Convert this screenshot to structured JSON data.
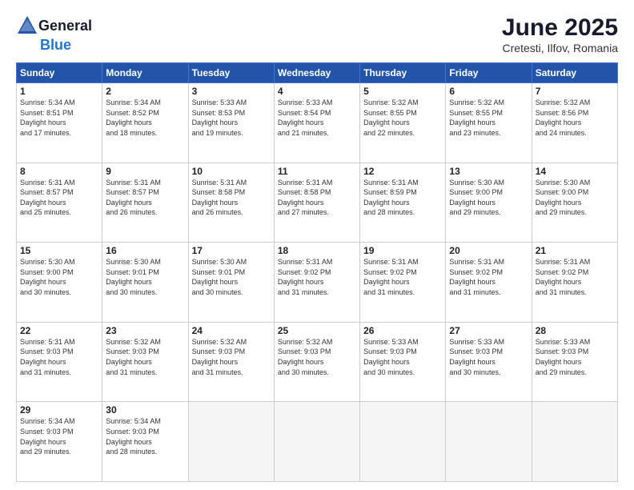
{
  "header": {
    "logo_line1": "General",
    "logo_line2": "Blue",
    "title": "June 2025",
    "subtitle": "Cretesti, Ilfov, Romania"
  },
  "days_of_week": [
    "Sunday",
    "Monday",
    "Tuesday",
    "Wednesday",
    "Thursday",
    "Friday",
    "Saturday"
  ],
  "weeks": [
    [
      {
        "day": 1,
        "sunrise": "5:34 AM",
        "sunset": "8:51 PM",
        "daylight": "15 hours and 17 minutes."
      },
      {
        "day": 2,
        "sunrise": "5:34 AM",
        "sunset": "8:52 PM",
        "daylight": "15 hours and 18 minutes."
      },
      {
        "day": 3,
        "sunrise": "5:33 AM",
        "sunset": "8:53 PM",
        "daylight": "15 hours and 19 minutes."
      },
      {
        "day": 4,
        "sunrise": "5:33 AM",
        "sunset": "8:54 PM",
        "daylight": "15 hours and 21 minutes."
      },
      {
        "day": 5,
        "sunrise": "5:32 AM",
        "sunset": "8:55 PM",
        "daylight": "15 hours and 22 minutes."
      },
      {
        "day": 6,
        "sunrise": "5:32 AM",
        "sunset": "8:55 PM",
        "daylight": "15 hours and 23 minutes."
      },
      {
        "day": 7,
        "sunrise": "5:32 AM",
        "sunset": "8:56 PM",
        "daylight": "15 hours and 24 minutes."
      }
    ],
    [
      {
        "day": 8,
        "sunrise": "5:31 AM",
        "sunset": "8:57 PM",
        "daylight": "15 hours and 25 minutes."
      },
      {
        "day": 9,
        "sunrise": "5:31 AM",
        "sunset": "8:57 PM",
        "daylight": "15 hours and 26 minutes."
      },
      {
        "day": 10,
        "sunrise": "5:31 AM",
        "sunset": "8:58 PM",
        "daylight": "15 hours and 26 minutes."
      },
      {
        "day": 11,
        "sunrise": "5:31 AM",
        "sunset": "8:58 PM",
        "daylight": "15 hours and 27 minutes."
      },
      {
        "day": 12,
        "sunrise": "5:31 AM",
        "sunset": "8:59 PM",
        "daylight": "15 hours and 28 minutes."
      },
      {
        "day": 13,
        "sunrise": "5:30 AM",
        "sunset": "9:00 PM",
        "daylight": "15 hours and 29 minutes."
      },
      {
        "day": 14,
        "sunrise": "5:30 AM",
        "sunset": "9:00 PM",
        "daylight": "15 hours and 29 minutes."
      }
    ],
    [
      {
        "day": 15,
        "sunrise": "5:30 AM",
        "sunset": "9:00 PM",
        "daylight": "15 hours and 30 minutes."
      },
      {
        "day": 16,
        "sunrise": "5:30 AM",
        "sunset": "9:01 PM",
        "daylight": "15 hours and 30 minutes."
      },
      {
        "day": 17,
        "sunrise": "5:30 AM",
        "sunset": "9:01 PM",
        "daylight": "15 hours and 30 minutes."
      },
      {
        "day": 18,
        "sunrise": "5:31 AM",
        "sunset": "9:02 PM",
        "daylight": "15 hours and 31 minutes."
      },
      {
        "day": 19,
        "sunrise": "5:31 AM",
        "sunset": "9:02 PM",
        "daylight": "15 hours and 31 minutes."
      },
      {
        "day": 20,
        "sunrise": "5:31 AM",
        "sunset": "9:02 PM",
        "daylight": "15 hours and 31 minutes."
      },
      {
        "day": 21,
        "sunrise": "5:31 AM",
        "sunset": "9:02 PM",
        "daylight": "15 hours and 31 minutes."
      }
    ],
    [
      {
        "day": 22,
        "sunrise": "5:31 AM",
        "sunset": "9:03 PM",
        "daylight": "15 hours and 31 minutes."
      },
      {
        "day": 23,
        "sunrise": "5:32 AM",
        "sunset": "9:03 PM",
        "daylight": "15 hours and 31 minutes."
      },
      {
        "day": 24,
        "sunrise": "5:32 AM",
        "sunset": "9:03 PM",
        "daylight": "15 hours and 31 minutes."
      },
      {
        "day": 25,
        "sunrise": "5:32 AM",
        "sunset": "9:03 PM",
        "daylight": "15 hours and 30 minutes."
      },
      {
        "day": 26,
        "sunrise": "5:33 AM",
        "sunset": "9:03 PM",
        "daylight": "15 hours and 30 minutes."
      },
      {
        "day": 27,
        "sunrise": "5:33 AM",
        "sunset": "9:03 PM",
        "daylight": "15 hours and 30 minutes."
      },
      {
        "day": 28,
        "sunrise": "5:33 AM",
        "sunset": "9:03 PM",
        "daylight": "15 hours and 29 minutes."
      }
    ],
    [
      {
        "day": 29,
        "sunrise": "5:34 AM",
        "sunset": "9:03 PM",
        "daylight": "15 hours and 29 minutes."
      },
      {
        "day": 30,
        "sunrise": "5:34 AM",
        "sunset": "9:03 PM",
        "daylight": "15 hours and 28 minutes."
      },
      null,
      null,
      null,
      null,
      null
    ]
  ]
}
